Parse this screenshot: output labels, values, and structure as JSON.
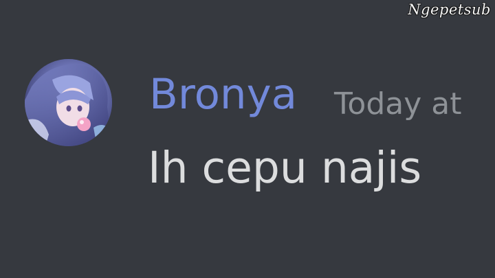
{
  "watermark": {
    "text": "Ngepetsub"
  },
  "message": {
    "author": "Bronya",
    "timestamp": "Today at",
    "content": "Ih cepu najis",
    "avatar_icon": "user-avatar-icon"
  },
  "colors": {
    "background": "#36393f",
    "username": "#7289da",
    "timestamp": "#8e9297",
    "message_text": "#dcddde"
  }
}
